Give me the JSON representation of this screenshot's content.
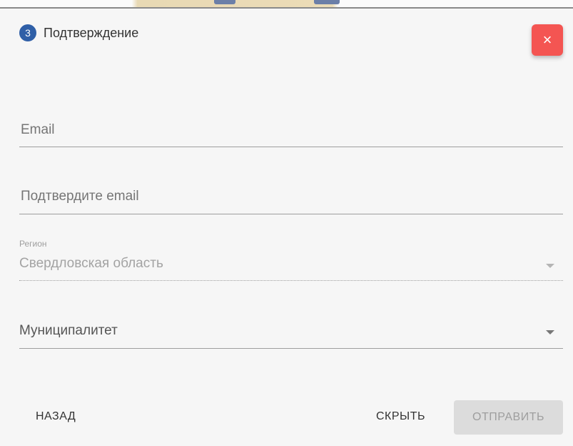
{
  "step": {
    "number": "3",
    "title": "Подтверждение"
  },
  "close": {
    "icon": "close-icon",
    "glyph": "×"
  },
  "form": {
    "email": {
      "placeholder": "Email",
      "value": ""
    },
    "confirm_email": {
      "placeholder": "Подтвердите email",
      "value": ""
    },
    "region": {
      "label": "Регион",
      "value": "Свердловская область",
      "disabled": true,
      "icon": "caret-down-icon"
    },
    "municipality": {
      "placeholder": "Муниципалитет",
      "value": "",
      "icon": "caret-down-icon"
    }
  },
  "footer": {
    "back_label": "НАЗАД",
    "hide_label": "СКРЫТЬ",
    "send_label": "ОТПРАВИТЬ"
  },
  "colors": {
    "step_badge": "#2f5fa7",
    "close_button": "#f45552",
    "send_button_disabled": "#dcdcdc"
  }
}
